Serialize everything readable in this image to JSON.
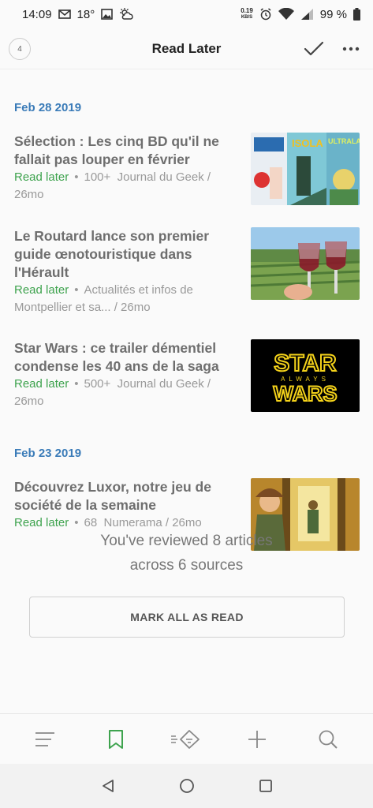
{
  "status": {
    "time": "14:09",
    "temperature": "18°",
    "net_speed_value": "0.19",
    "net_speed_unit": "KB/S",
    "battery": "99 %"
  },
  "app_bar": {
    "counter": "4",
    "title": "Read Later"
  },
  "sections": [
    {
      "date": "Feb 28 2019",
      "articles": [
        {
          "title": "Sélection : Les cinq BD qu'il ne fallait pas louper en février",
          "tag": "Read later",
          "count": "100+",
          "source": "Journal du Geek / 26mo"
        },
        {
          "title": "Le Routard lance son premier guide œnotouristique dans l'Hérault",
          "tag": "Read later",
          "source": "Actualités et infos de Montpellier et sa... / 26mo"
        },
        {
          "title": "Star Wars : ce trailer démentiel condense les 40 ans de la saga",
          "tag": "Read later",
          "count": "500+",
          "source": "Journal du Geek / 26mo"
        }
      ]
    },
    {
      "date": "Feb 23 2019",
      "articles": [
        {
          "title": "Découvrez Luxor, notre jeu de société de la semaine",
          "tag": "Read later",
          "count": "68",
          "source": "Numerama / 26mo"
        }
      ]
    }
  ],
  "summary": {
    "line1": "You've reviewed 8 articles",
    "line2": "across 6 sources"
  },
  "mark_all_label": "MARK ALL AS READ",
  "thumb_text": {
    "bd_title": "ISOLA",
    "bd_title2": "ULTRALAZ",
    "sw_line1": "STAR",
    "sw_line2": "ALWAYS",
    "sw_line3": "WARS"
  },
  "colors": {
    "accent_green": "#3ea34e",
    "date_blue": "#3a7bb8"
  }
}
